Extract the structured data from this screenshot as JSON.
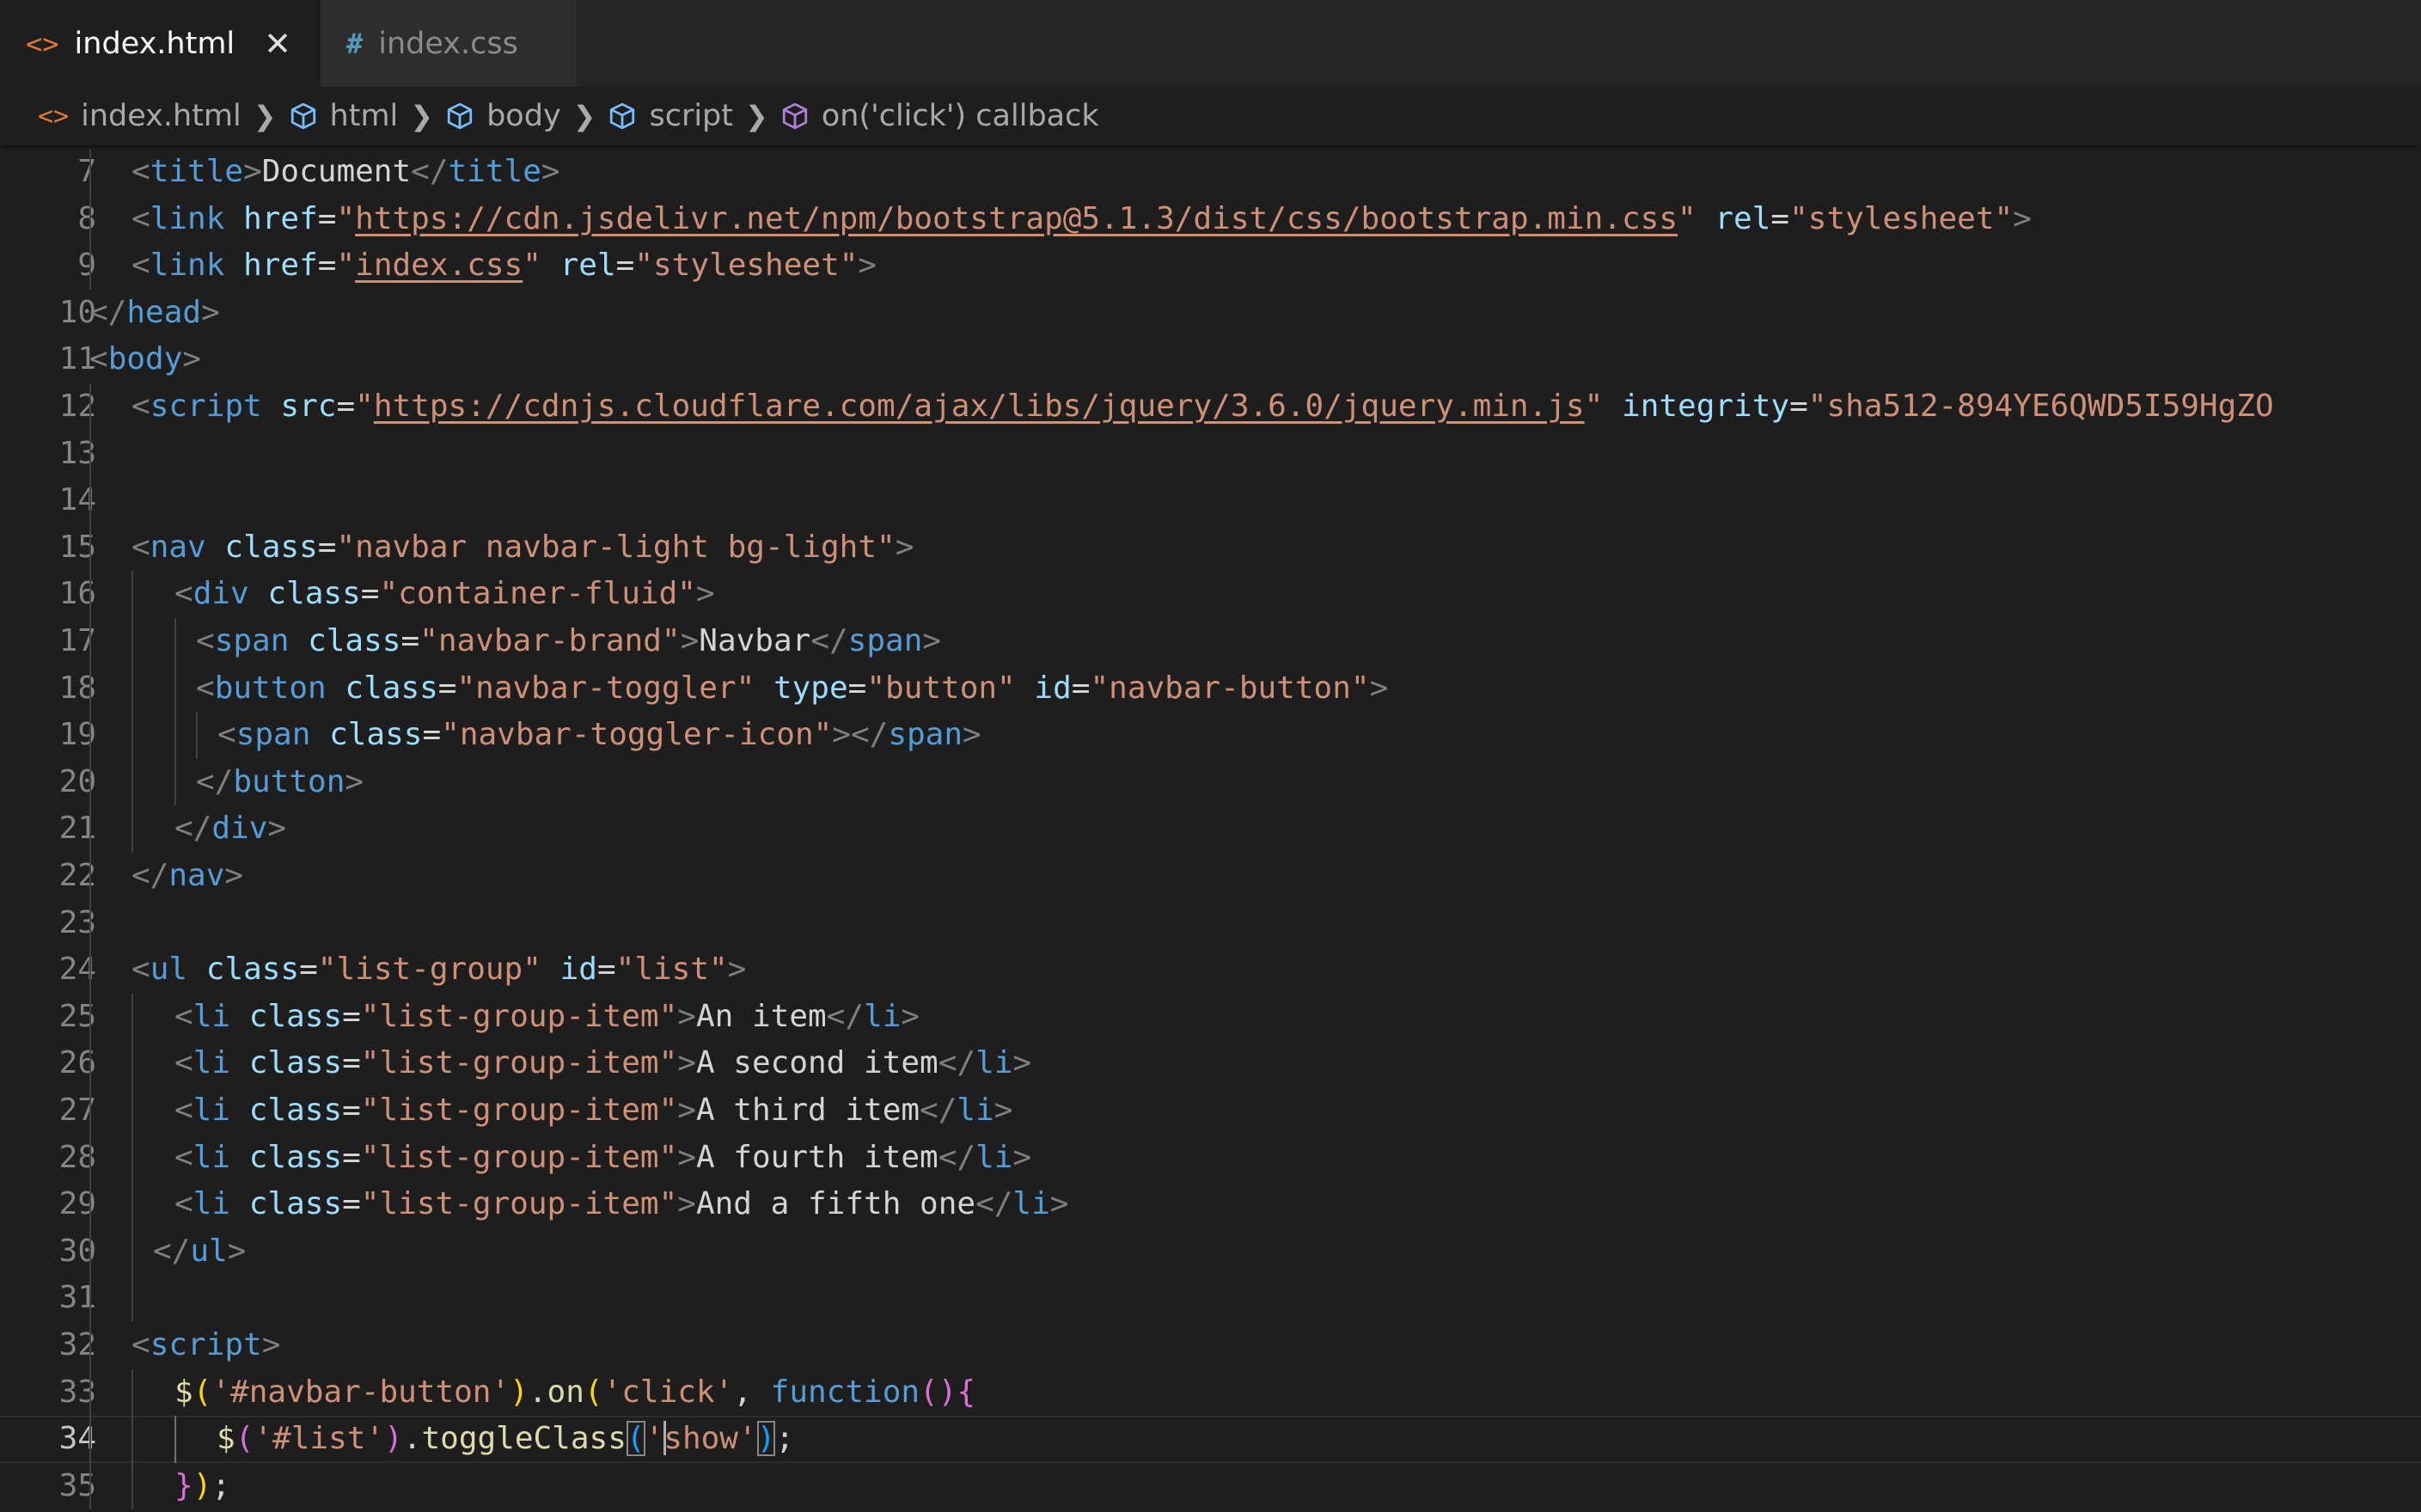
{
  "tabs": [
    {
      "label": "index.html",
      "icon": "html-brackets-icon",
      "active": true,
      "close": "✕"
    },
    {
      "label": "index.css",
      "icon": "css-hash-icon",
      "active": false
    }
  ],
  "breadcrumb": [
    {
      "label": "index.html",
      "icon": "html-file-icon"
    },
    {
      "label": "html",
      "icon": "cube-icon"
    },
    {
      "label": "body",
      "icon": "cube-icon"
    },
    {
      "label": "script",
      "icon": "cube-icon"
    },
    {
      "label": "on('click') callback",
      "icon": "method-cube-icon"
    }
  ],
  "editor": {
    "current_line": "34",
    "lines": [
      {
        "n": "7",
        "tokens": [
          [
            "br",
            "<"
          ],
          [
            "tag",
            "title"
          ],
          [
            "br",
            ">"
          ],
          [
            "txt",
            "Document"
          ],
          [
            "br",
            "</"
          ],
          [
            "tag",
            "title"
          ],
          [
            "br",
            ">"
          ]
        ]
      },
      {
        "n": "8",
        "tokens": [
          [
            "br",
            "<"
          ],
          [
            "tag",
            "link"
          ],
          [
            "txt",
            " "
          ],
          [
            "attr",
            "href"
          ],
          [
            "txt",
            "="
          ],
          [
            "str",
            "\""
          ],
          [
            "link",
            "https://cdn.jsdelivr.net/npm/bootstrap@5.1.3/dist/css/bootstrap.min.css"
          ],
          [
            "str",
            "\""
          ],
          [
            "txt",
            " "
          ],
          [
            "attr",
            "rel"
          ],
          [
            "txt",
            "="
          ],
          [
            "str",
            "\"stylesheet\""
          ],
          [
            "br",
            ">"
          ]
        ]
      },
      {
        "n": "9",
        "tokens": [
          [
            "br",
            "<"
          ],
          [
            "tag",
            "link"
          ],
          [
            "txt",
            " "
          ],
          [
            "attr",
            "href"
          ],
          [
            "txt",
            "="
          ],
          [
            "str",
            "\""
          ],
          [
            "link",
            "index.css"
          ],
          [
            "str",
            "\""
          ],
          [
            "txt",
            " "
          ],
          [
            "attr",
            "rel"
          ],
          [
            "txt",
            "="
          ],
          [
            "str",
            "\"stylesheet\""
          ],
          [
            "br",
            ">"
          ]
        ]
      },
      {
        "n": "10",
        "tokens": [
          [
            "br",
            "</"
          ],
          [
            "tag",
            "head"
          ],
          [
            "br",
            ">"
          ]
        ]
      },
      {
        "n": "11",
        "tokens": [
          [
            "br",
            "<"
          ],
          [
            "tag",
            "body"
          ],
          [
            "br",
            ">"
          ]
        ]
      },
      {
        "n": "12",
        "tokens": [
          [
            "br",
            "<"
          ],
          [
            "tag",
            "script"
          ],
          [
            "txt",
            " "
          ],
          [
            "attr",
            "src"
          ],
          [
            "txt",
            "="
          ],
          [
            "str",
            "\""
          ],
          [
            "link",
            "https://cdnjs.cloudflare.com/ajax/libs/jquery/3.6.0/jquery.min.js"
          ],
          [
            "str",
            "\""
          ],
          [
            "txt",
            " "
          ],
          [
            "attr",
            "integrity"
          ],
          [
            "txt",
            "="
          ],
          [
            "str",
            "\"sha512-894YE6QWD5I59HgZO"
          ]
        ]
      },
      {
        "n": "13",
        "tokens": []
      },
      {
        "n": "14",
        "tokens": []
      },
      {
        "n": "15",
        "tokens": [
          [
            "br",
            "<"
          ],
          [
            "tag",
            "nav"
          ],
          [
            "txt",
            " "
          ],
          [
            "attr",
            "class"
          ],
          [
            "txt",
            "="
          ],
          [
            "str",
            "\"navbar navbar-light bg-light\""
          ],
          [
            "br",
            ">"
          ]
        ]
      },
      {
        "n": "16",
        "tokens": [
          [
            "br",
            "<"
          ],
          [
            "tag",
            "div"
          ],
          [
            "txt",
            " "
          ],
          [
            "attr",
            "class"
          ],
          [
            "txt",
            "="
          ],
          [
            "str",
            "\"container-fluid\""
          ],
          [
            "br",
            ">"
          ]
        ]
      },
      {
        "n": "17",
        "tokens": [
          [
            "br",
            "<"
          ],
          [
            "tag",
            "span"
          ],
          [
            "txt",
            " "
          ],
          [
            "attr",
            "class"
          ],
          [
            "txt",
            "="
          ],
          [
            "str",
            "\"navbar-brand\""
          ],
          [
            "br",
            ">"
          ],
          [
            "txt",
            "Navbar"
          ],
          [
            "br",
            "</"
          ],
          [
            "tag",
            "span"
          ],
          [
            "br",
            ">"
          ]
        ]
      },
      {
        "n": "18",
        "tokens": [
          [
            "br",
            "<"
          ],
          [
            "tag",
            "button"
          ],
          [
            "txt",
            " "
          ],
          [
            "attr",
            "class"
          ],
          [
            "txt",
            "="
          ],
          [
            "str",
            "\"navbar-toggler\""
          ],
          [
            "txt",
            " "
          ],
          [
            "attr",
            "type"
          ],
          [
            "txt",
            "="
          ],
          [
            "str",
            "\"button\""
          ],
          [
            "txt",
            " "
          ],
          [
            "attr",
            "id"
          ],
          [
            "txt",
            "="
          ],
          [
            "str",
            "\"navbar-button\""
          ],
          [
            "br",
            ">"
          ]
        ]
      },
      {
        "n": "19",
        "tokens": [
          [
            "br",
            "<"
          ],
          [
            "tag",
            "span"
          ],
          [
            "txt",
            " "
          ],
          [
            "attr",
            "class"
          ],
          [
            "txt",
            "="
          ],
          [
            "str",
            "\"navbar-toggler-icon\""
          ],
          [
            "br",
            "></"
          ],
          [
            "tag",
            "span"
          ],
          [
            "br",
            ">"
          ]
        ]
      },
      {
        "n": "20",
        "tokens": [
          [
            "br",
            "</"
          ],
          [
            "tag",
            "button"
          ],
          [
            "br",
            ">"
          ]
        ]
      },
      {
        "n": "21",
        "tokens": [
          [
            "br",
            "</"
          ],
          [
            "tag",
            "div"
          ],
          [
            "br",
            ">"
          ]
        ]
      },
      {
        "n": "22",
        "tokens": [
          [
            "br",
            "</"
          ],
          [
            "tag",
            "nav"
          ],
          [
            "br",
            ">"
          ]
        ]
      },
      {
        "n": "23",
        "tokens": []
      },
      {
        "n": "24",
        "tokens": [
          [
            "br",
            "<"
          ],
          [
            "tag",
            "ul"
          ],
          [
            "txt",
            " "
          ],
          [
            "attr",
            "class"
          ],
          [
            "txt",
            "="
          ],
          [
            "str",
            "\"list-group\""
          ],
          [
            "txt",
            " "
          ],
          [
            "attr",
            "id"
          ],
          [
            "txt",
            "="
          ],
          [
            "str",
            "\"list\""
          ],
          [
            "br",
            ">"
          ]
        ]
      },
      {
        "n": "25",
        "tokens": [
          [
            "br",
            "<"
          ],
          [
            "tag",
            "li"
          ],
          [
            "txt",
            " "
          ],
          [
            "attr",
            "class"
          ],
          [
            "txt",
            "="
          ],
          [
            "str",
            "\"list-group-item\""
          ],
          [
            "br",
            ">"
          ],
          [
            "txt",
            "An item"
          ],
          [
            "br",
            "</"
          ],
          [
            "tag",
            "li"
          ],
          [
            "br",
            ">"
          ]
        ]
      },
      {
        "n": "26",
        "tokens": [
          [
            "br",
            "<"
          ],
          [
            "tag",
            "li"
          ],
          [
            "txt",
            " "
          ],
          [
            "attr",
            "class"
          ],
          [
            "txt",
            "="
          ],
          [
            "str",
            "\"list-group-item\""
          ],
          [
            "br",
            ">"
          ],
          [
            "txt",
            "A second item"
          ],
          [
            "br",
            "</"
          ],
          [
            "tag",
            "li"
          ],
          [
            "br",
            ">"
          ]
        ]
      },
      {
        "n": "27",
        "tokens": [
          [
            "br",
            "<"
          ],
          [
            "tag",
            "li"
          ],
          [
            "txt",
            " "
          ],
          [
            "attr",
            "class"
          ],
          [
            "txt",
            "="
          ],
          [
            "str",
            "\"list-group-item\""
          ],
          [
            "br",
            ">"
          ],
          [
            "txt",
            "A third item"
          ],
          [
            "br",
            "</"
          ],
          [
            "tag",
            "li"
          ],
          [
            "br",
            ">"
          ]
        ]
      },
      {
        "n": "28",
        "tokens": [
          [
            "br",
            "<"
          ],
          [
            "tag",
            "li"
          ],
          [
            "txt",
            " "
          ],
          [
            "attr",
            "class"
          ],
          [
            "txt",
            "="
          ],
          [
            "str",
            "\"list-group-item\""
          ],
          [
            "br",
            ">"
          ],
          [
            "txt",
            "A fourth item"
          ],
          [
            "br",
            "</"
          ],
          [
            "tag",
            "li"
          ],
          [
            "br",
            ">"
          ]
        ]
      },
      {
        "n": "29",
        "tokens": [
          [
            "br",
            "<"
          ],
          [
            "tag",
            "li"
          ],
          [
            "txt",
            " "
          ],
          [
            "attr",
            "class"
          ],
          [
            "txt",
            "="
          ],
          [
            "str",
            "\"list-group-item\""
          ],
          [
            "br",
            ">"
          ],
          [
            "txt",
            "And a fifth one"
          ],
          [
            "br",
            "</"
          ],
          [
            "tag",
            "li"
          ],
          [
            "br",
            ">"
          ]
        ]
      },
      {
        "n": "30",
        "tokens": [
          [
            "br",
            "</"
          ],
          [
            "tag",
            "ul"
          ],
          [
            "br",
            ">"
          ]
        ]
      },
      {
        "n": "31",
        "tokens": []
      },
      {
        "n": "32",
        "tokens": [
          [
            "br",
            "<"
          ],
          [
            "tag",
            "script"
          ],
          [
            "br",
            ">"
          ]
        ]
      },
      {
        "n": "33",
        "tokens": [
          [
            "fn",
            "$"
          ],
          [
            "y",
            "("
          ],
          [
            "str",
            "'#navbar-button'"
          ],
          [
            "y",
            ")"
          ],
          [
            "txt",
            "."
          ],
          [
            "fn",
            "on"
          ],
          [
            "y",
            "("
          ],
          [
            "str",
            "'click'"
          ],
          [
            "txt",
            ", "
          ],
          [
            "kw",
            "function"
          ],
          [
            "p",
            "()"
          ],
          [
            "p",
            "{"
          ]
        ]
      },
      {
        "n": "34",
        "tokens": [
          [
            "fn",
            "$"
          ],
          [
            "p",
            "("
          ],
          [
            "str",
            "'#list'"
          ],
          [
            "p",
            ")"
          ],
          [
            "txt",
            "."
          ],
          [
            "fn",
            "toggleClass"
          ],
          [
            "bm",
            "("
          ],
          [
            "str",
            "'"
          ],
          [
            "cursor",
            ""
          ],
          [
            "str",
            "show'"
          ],
          [
            "bm",
            ")"
          ],
          [
            "txt",
            ";"
          ]
        ]
      },
      {
        "n": "35",
        "tokens": [
          [
            "p",
            "}"
          ],
          [
            "y",
            ")"
          ],
          [
            "txt",
            ";"
          ]
        ]
      }
    ]
  }
}
